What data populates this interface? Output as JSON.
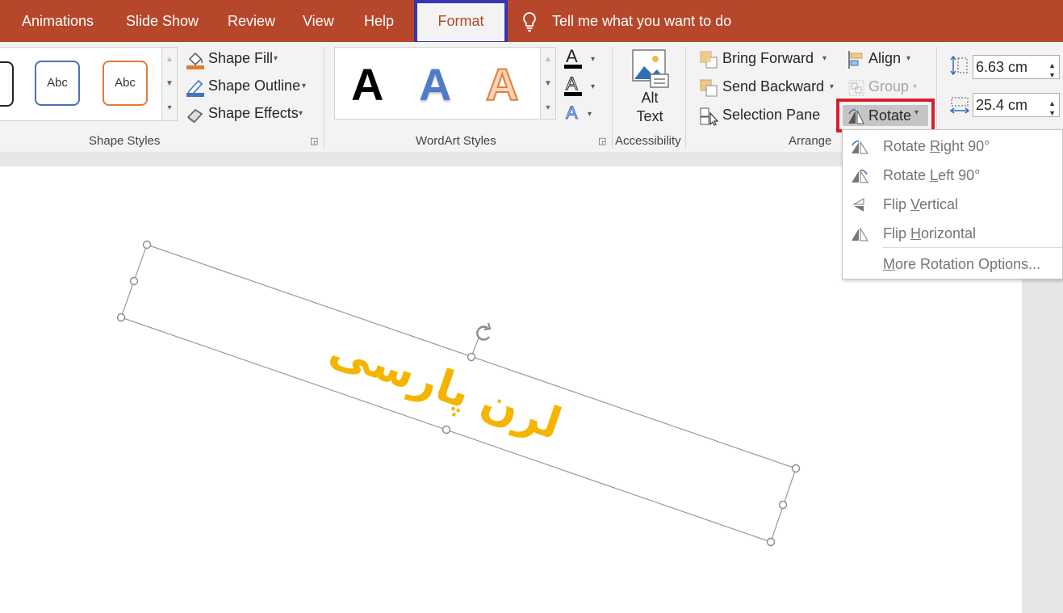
{
  "tabs": [
    {
      "label": "Animations"
    },
    {
      "label": "Slide Show"
    },
    {
      "label": "Review"
    },
    {
      "label": "View"
    },
    {
      "label": "Help"
    },
    {
      "label": "Format"
    }
  ],
  "tellme": "Tell me what you want to do",
  "shape_styles": {
    "sample": "Abc",
    "fill": "Shape Fill",
    "outline": "Shape Outline",
    "effects": "Shape Effects",
    "group_label": "Shape Styles"
  },
  "wordart": {
    "letter": "A",
    "group_label": "WordArt Styles"
  },
  "accessibility": {
    "alt_line1": "Alt",
    "alt_line2": "Text",
    "group_label": "Accessibility"
  },
  "arrange": {
    "bring_forward": "Bring Forward",
    "send_backward": "Send Backward",
    "selection_pane": "Selection Pane",
    "align": "Align",
    "group": "Group",
    "rotate": "Rotate",
    "group_label": "Arrange"
  },
  "size": {
    "height": "6.63 cm",
    "width": "25.4 cm"
  },
  "rotate_menu": {
    "right_pre": "Rotate ",
    "right_key": "R",
    "right_post": "ight 90°",
    "left_pre": "Rotate ",
    "left_key": "L",
    "left_post": "eft 90°",
    "vert_pre": "Flip ",
    "vert_key": "V",
    "vert_post": "ertical",
    "horiz_pre": "Flip ",
    "horiz_key": "H",
    "horiz_post": "orizontal",
    "more_key": "M",
    "more_post": "ore Rotation Options..."
  },
  "slide_text": "لرن پارسی",
  "colors": {
    "tab_bar": "#b7472a",
    "format_outline": "#3535b5",
    "rotate_outline": "#d4202c",
    "slide_text": "#f5b400"
  }
}
